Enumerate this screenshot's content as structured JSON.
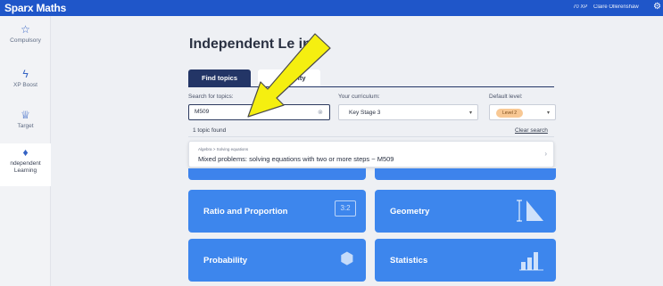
{
  "header": {
    "brand": "Sparx Maths",
    "xp": "70 XP",
    "user": "Claire Ollerenshaw"
  },
  "sidebar": {
    "items": [
      {
        "label": "Compulsory",
        "icon": "star-icon"
      },
      {
        "label": "XP Boost",
        "icon": "lightning-icon"
      },
      {
        "label": "Target",
        "icon": "crown-icon"
      },
      {
        "label": "ndependent Learning",
        "icon": "rocket-icon"
      }
    ]
  },
  "main": {
    "title": "Independent Le   ing",
    "tabs": [
      {
        "label": "Find topics"
      },
      {
        "label": "ivity"
      }
    ],
    "search": {
      "label": "Search for topics:",
      "value": "M509"
    },
    "curriculum": {
      "label": "Your curriculum:",
      "value": "Key Stage 3"
    },
    "level": {
      "label": "Default level:",
      "value": "Level 2"
    },
    "found": "1 topic found",
    "clear_search": "Clear search",
    "result": {
      "crumb": "Algebra > Solving equations",
      "title": "Mixed problems: solving equations with two or more steps ~ M509"
    },
    "cards": [
      {
        "name": "Ratio and Proportion",
        "icon_text": "3:2"
      },
      {
        "name": "Geometry"
      },
      {
        "name": "Probability"
      },
      {
        "name": "Statistics"
      }
    ]
  },
  "colors": {
    "brand_blue": "#1f56c9",
    "card_blue": "#3d86ed",
    "tab_navy": "#233566",
    "arrow_yellow": "#f5ef10"
  }
}
